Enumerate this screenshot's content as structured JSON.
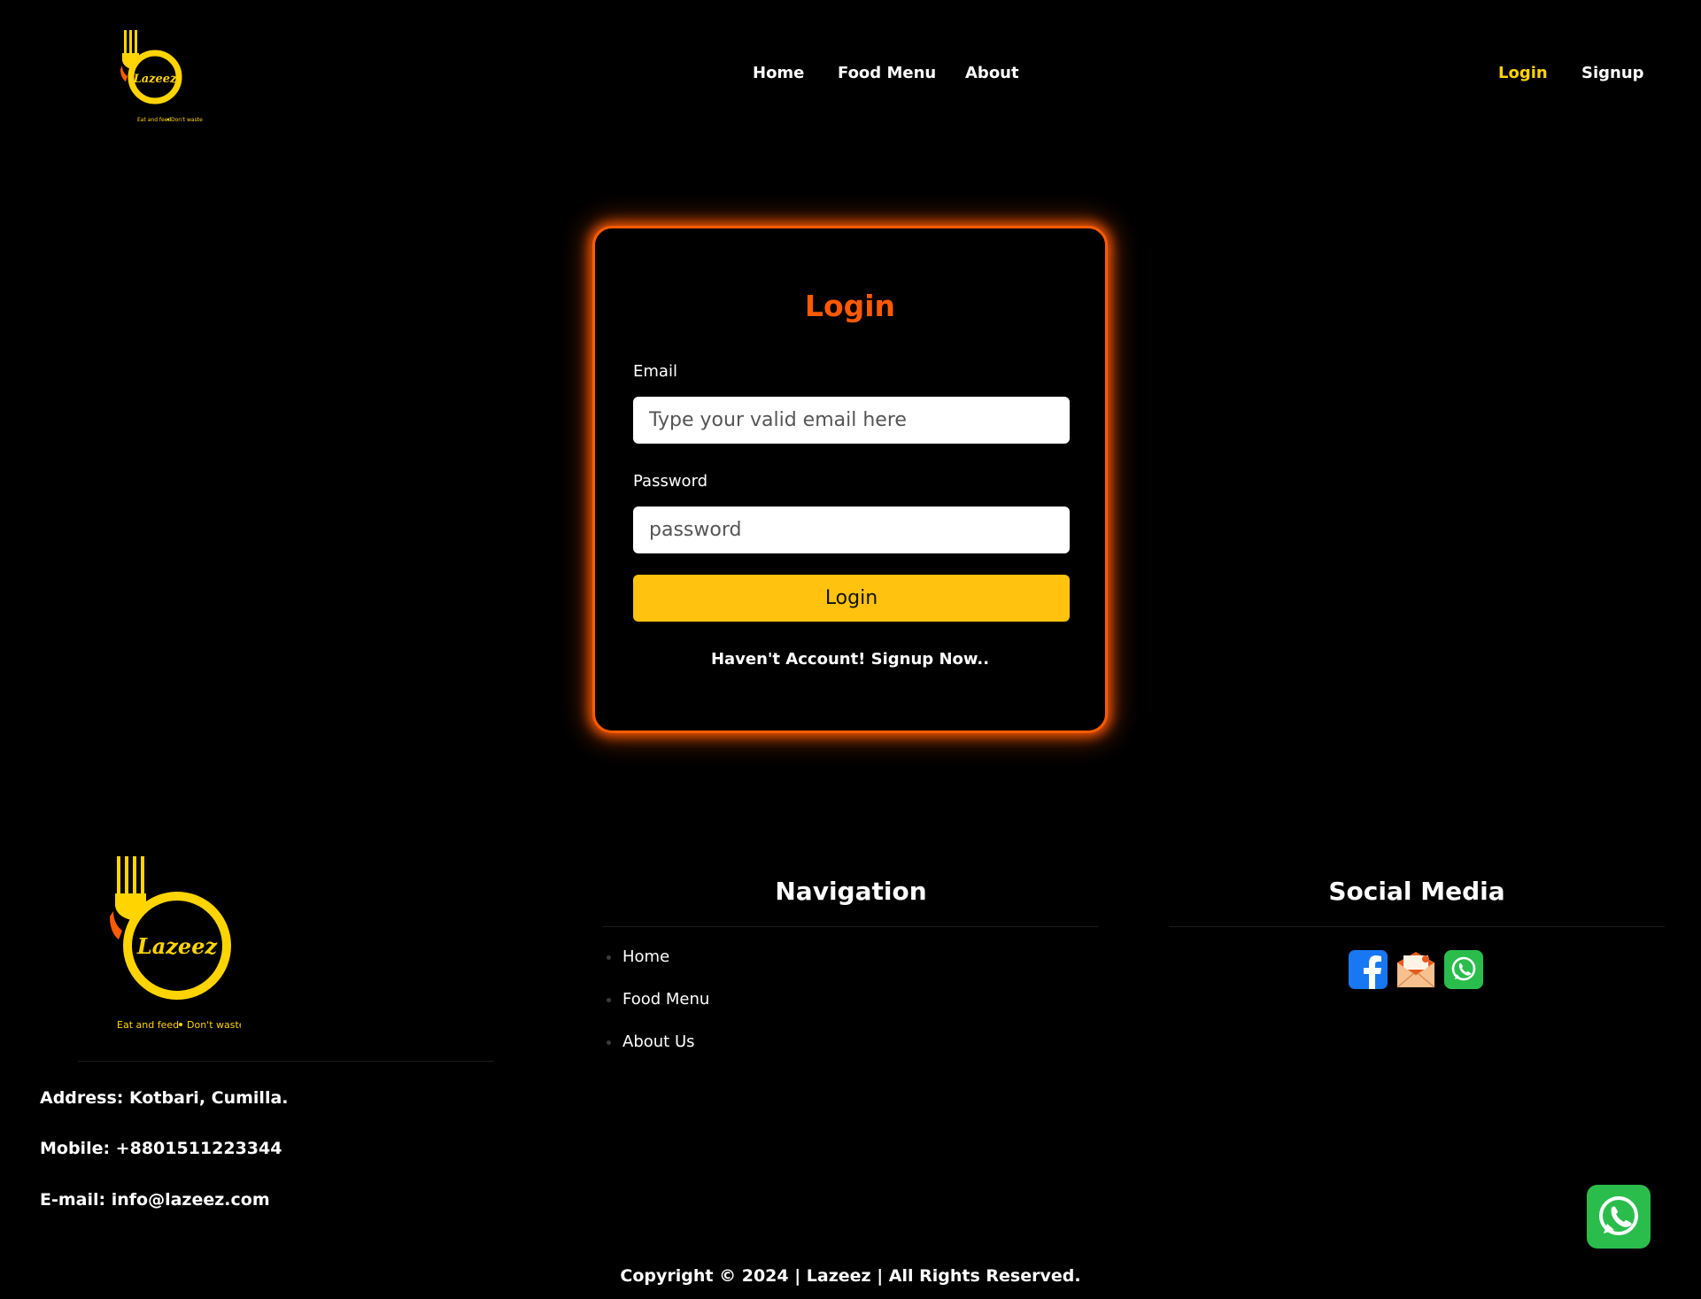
{
  "brand": {
    "logo_text": "Lazeez",
    "tagline_left": "Eat and feed",
    "tagline_right": "Don't waste",
    "colors": {
      "yellow": "#ffd400",
      "orange": "#ff5a00",
      "button": "#ffc20e"
    }
  },
  "header": {
    "nav": [
      {
        "label": "Home"
      },
      {
        "label": "Food Menu"
      },
      {
        "label": "About"
      }
    ],
    "auth": [
      {
        "label": "Login",
        "active": true
      },
      {
        "label": "Signup",
        "active": false
      }
    ]
  },
  "login_card": {
    "title": "Login",
    "email_label": "Email",
    "email_placeholder": "Type your valid email here",
    "email_value": "",
    "password_label": "Password",
    "password_placeholder": "password",
    "password_value": "",
    "submit_label": "Login",
    "signup_text": "Haven't Account! Signup Now.."
  },
  "footer": {
    "contact": [
      "Address: Kotbari, Cumilla.",
      "Mobile: +8801511223344",
      "E-mail: info@lazeez.com"
    ],
    "navigation_heading": "Navigation",
    "navigation_links": [
      "Home",
      "Food Menu",
      "About Us"
    ],
    "social_heading": "Social Media",
    "social_icons": [
      "facebook-icon",
      "email-icon",
      "whatsapp-icon"
    ],
    "copyright": "Copyright © 2024 | Lazeez | All Rights Reserved."
  },
  "floating_button": {
    "icon": "whatsapp-icon"
  }
}
